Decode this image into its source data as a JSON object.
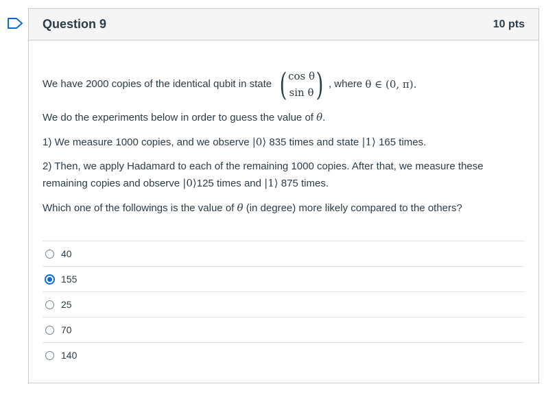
{
  "question": {
    "title": "Question 9",
    "points": "10 pts"
  },
  "body": {
    "intro_before": "We have 2000 copies of the identical qubit in state",
    "vector_top": "cos θ",
    "vector_bottom": "sin θ",
    "intro_where": ", where",
    "intro_condition": "θ ∈ (0, π).",
    "line2_text": "We do the experiments below in order to guess the value of",
    "line2_symbol": "θ",
    "line2_end": ".",
    "line3_prefix": "1) We measure 1000 copies, and we observe",
    "line3_ket0": "|0⟩",
    "line3_mid": "835 times and state",
    "line3_ket1": "|1⟩",
    "line3_suffix": "165 times.",
    "line4_a": "2) Then, we apply Hadamard to each of the remaining 1000 copies. After that, we measure these",
    "line4_b_prefix": "remaining copies and observe",
    "line4_ket0": "|0⟩",
    "line4_mid": "125 times and",
    "line4_ket1": "|1⟩",
    "line4_suffix": "875 times.",
    "line5_prefix": "Which one of the followings is the value of",
    "line5_symbol": "θ",
    "line5_suffix": "(in degree) more likely compared to the others?"
  },
  "answers": [
    {
      "label": "40",
      "selected": false
    },
    {
      "label": "155",
      "selected": true
    },
    {
      "label": "25",
      "selected": false
    },
    {
      "label": "70",
      "selected": false
    },
    {
      "label": "140",
      "selected": false
    }
  ],
  "colors": {
    "accent": "#0b6bd6",
    "text": "#2d3b45",
    "border": "#c7cdd1",
    "header_bg": "#f5f5f5"
  }
}
